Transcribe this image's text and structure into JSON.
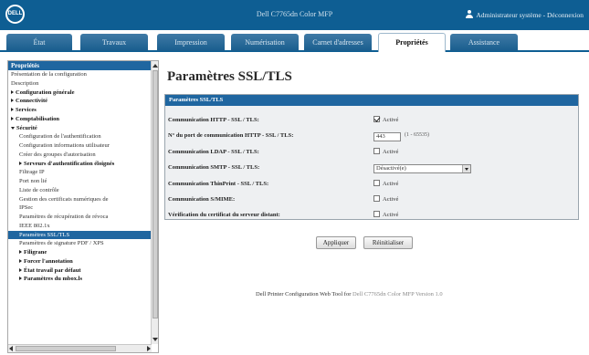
{
  "header": {
    "logo": "DELL",
    "title": "Dell C7765dn Color MFP",
    "user": "Administrateur système - Déconnexion"
  },
  "tabs": [
    {
      "label": "État"
    },
    {
      "label": "Travaux"
    },
    {
      "label": "Impression"
    },
    {
      "label": "Numérisation"
    },
    {
      "label": "Carnet d'adresses"
    },
    {
      "label": "Propriétés",
      "active": true
    },
    {
      "label": "Assistance"
    }
  ],
  "sidebar": {
    "header": "Propriétés",
    "items": [
      {
        "label": "Présentation de la configuration",
        "level": 0
      },
      {
        "label": "Description",
        "level": 0
      },
      {
        "label": "Configuration générale",
        "level": 0,
        "expander": "right",
        "bold": true
      },
      {
        "label": "Connectivité",
        "level": 0,
        "expander": "right",
        "bold": true
      },
      {
        "label": "Services",
        "level": 0,
        "expander": "right",
        "bold": true
      },
      {
        "label": "Comptabilisation",
        "level": 0,
        "expander": "right",
        "bold": true
      },
      {
        "label": "Sécurité",
        "level": 0,
        "expander": "down",
        "bold": true
      },
      {
        "label": "Configuration de l'authentification",
        "level": 1
      },
      {
        "label": "Configuration informations utilisateur",
        "level": 1
      },
      {
        "label": "Créer des groupes d'autorisation",
        "level": 1
      },
      {
        "label": "Serveurs d'authentification éloignés",
        "level": 1,
        "expander": "right",
        "bold": true
      },
      {
        "label": "Filtrage IP",
        "level": 1
      },
      {
        "label": "Port non lié",
        "level": 1
      },
      {
        "label": "Liste de contrôle",
        "level": 1
      },
      {
        "label": "Gestion des certificats numériques de",
        "level": 1
      },
      {
        "label": "IPSec",
        "level": 1
      },
      {
        "label": "Paramètres de récupération de révoca",
        "level": 1
      },
      {
        "label": "IEEE 802.1x",
        "level": 1
      },
      {
        "label": "Paramètres SSL/TLS",
        "level": 1,
        "selected": true
      },
      {
        "label": "Paramètres de signature PDF / XPS",
        "level": 1
      },
      {
        "label": "Filigrane",
        "level": 1,
        "expander": "right",
        "bold": true
      },
      {
        "label": "Forcer l'annotation",
        "level": 1,
        "expander": "right",
        "bold": true
      },
      {
        "label": "État travail par défaut",
        "level": 1,
        "expander": "right",
        "bold": true
      },
      {
        "label": "Paramètres du mbox.ls",
        "level": 1,
        "expander": "right",
        "bold": true
      }
    ]
  },
  "main": {
    "title": "Paramètres SSL/TLS",
    "panel_header": "Paramètres SSL/TLS",
    "rows": [
      {
        "label": "Communication HTTP - SSL / TLS:",
        "type": "checkbox",
        "checked": true,
        "text": "Activé"
      },
      {
        "label": "N° du port de communication HTTP - SSL / TLS:",
        "type": "text",
        "value": "443",
        "hint": "(1 - 65535)"
      },
      {
        "label": "Communication LDAP - SSL / TLS:",
        "type": "checkbox",
        "checked": false,
        "text": "Activé"
      },
      {
        "label": "Communication SMTP - SSL / TLS:",
        "type": "select",
        "value": "Désactivé(e)"
      },
      {
        "label": "Communication ThinPrint - SSL / TLS:",
        "type": "checkbox",
        "checked": false,
        "text": "Activé"
      },
      {
        "label": "Communication S/MIME:",
        "type": "checkbox",
        "checked": false,
        "text": "Activé"
      },
      {
        "label": "Vérification du certificat du serveur distant:",
        "type": "checkbox",
        "checked": false,
        "text": "Activé"
      }
    ],
    "apply_label": "Appliquer",
    "reset_label": "Réinitialiser"
  },
  "footer": {
    "text": "Dell Printer Configuration Web Tool for",
    "device": "Dell C7765dn Color MFP Version 1.0"
  }
}
